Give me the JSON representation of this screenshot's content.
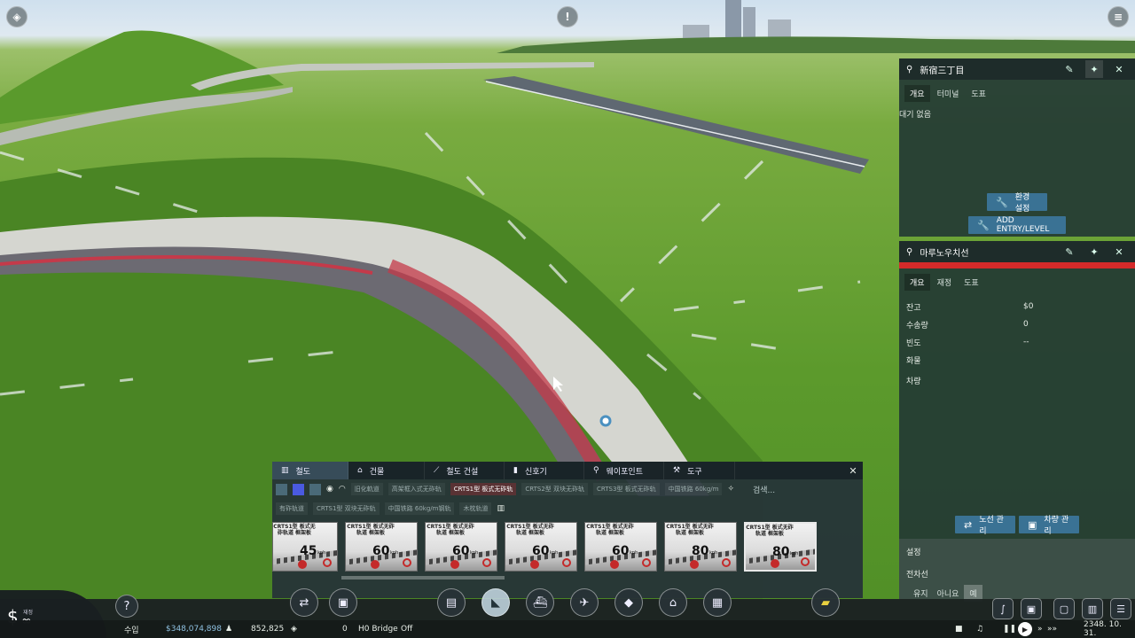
{
  "station_panel": {
    "title": "新宿三丁目",
    "tabs": [
      "개요",
      "터미널",
      "도표"
    ],
    "status": "대기 없음",
    "env_button": "환경 설정",
    "entry_button": "ADD ENTRY/LEVEL"
  },
  "line_panel": {
    "title": "마루노우치선",
    "line_color": "#d42a2a",
    "tabs": [
      "개요",
      "재정",
      "도표"
    ],
    "rows": [
      {
        "key": "잔고",
        "value": "$0"
      },
      {
        "key": "수송량",
        "value": "0"
      },
      {
        "key": "빈도",
        "value": "--"
      },
      {
        "key": "화물",
        "value": ""
      },
      {
        "key": "차량",
        "value": ""
      }
    ],
    "line_manage_button": "노선 관리",
    "vehicle_manage_button": "차량 관리",
    "settings_label": "설정",
    "electrify_label": "전차선",
    "options": [
      "유지",
      "아니요",
      "예"
    ],
    "selected_option": "예"
  },
  "build_panel": {
    "tabs": [
      "철도",
      "건물",
      "철도 건설",
      "신호기",
      "웨이포인트",
      "도구"
    ],
    "tab_icons": [
      "track-icon",
      "building-icon",
      "rail-build-icon",
      "signal-icon",
      "waypoint-icon",
      "tools-icon"
    ],
    "selected_tab": 0,
    "search_placeholder": "검색...",
    "filter_chips_row1": [
      "旧化軌道",
      "高架框入式无砟轨",
      "CRTS1型 板式无砟轨",
      "CRTS2型 双块无砟轨",
      "CRTS3型 板式无砟轨",
      "中国铁路 60kg/m"
    ],
    "filter_chips_row2": [
      "有砟轨道",
      "CRTS1型 双块无砟轨",
      "中国铁路 60kg/m钢轨",
      "木枕轨道"
    ],
    "track_cards": [
      {
        "name": "CRTS1型 板式无砟轨道 框架板",
        "speed": "45",
        "unit": "kph"
      },
      {
        "name": "CRTS1型 板式无砟轨道 框架板",
        "speed": "60",
        "unit": "kph"
      },
      {
        "name": "CRTS1型 板式无砟轨道 框架板",
        "speed": "60",
        "unit": "kph"
      },
      {
        "name": "CRTS1型 板式无砟轨道 框架板",
        "speed": "60",
        "unit": "kph"
      },
      {
        "name": "CRTS1型 板式无砟轨道 框架板",
        "speed": "60",
        "unit": "kph"
      },
      {
        "name": "CRTS1型 板式无砟轨道 框架板",
        "speed": "80",
        "unit": "kph"
      },
      {
        "name": "CRTS1型 板式无砟轨道 框架板",
        "speed": "80",
        "unit": "kph"
      }
    ],
    "selected_card": 6
  },
  "status_bar": {
    "money_symbol": "$",
    "money_caption": "재정",
    "money_value": "∞",
    "income_label": "수입",
    "income_value": "$348,074,898",
    "population": "852,825",
    "cargo": "0",
    "bridge_mode": "H0 Bridge",
    "bridge_state": "Off",
    "date": "2348. 10. 31."
  },
  "toolbar_icons": [
    "help-icon",
    "lines-icon",
    "vehicles-icon",
    "depot-icon",
    "train-icon",
    "station-icon",
    "airport-icon",
    "terrain-icon",
    "town-icon",
    "industry-icon",
    "bulldozer-icon"
  ],
  "right_tools": [
    "track-tool-icon",
    "bus-stop-icon",
    "train-stop-icon",
    "city-icon",
    "settings-icon"
  ]
}
